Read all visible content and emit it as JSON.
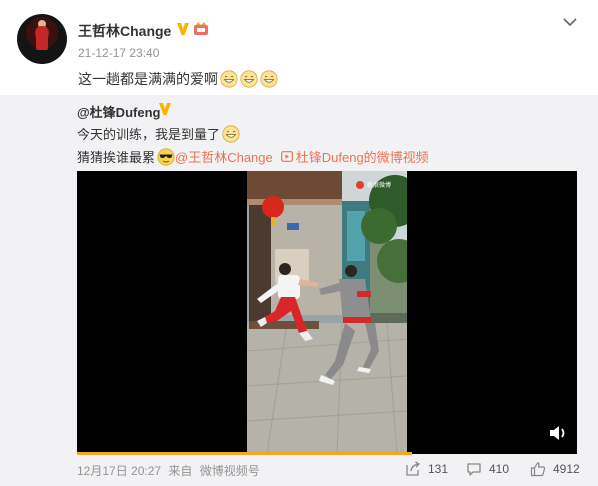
{
  "post": {
    "username": "王哲林Change",
    "timestamp": "21-12-17 23:40",
    "text": "这一趟都是满满的爱啊",
    "emoji_count": 3,
    "emoji_icon": "grin-emoji-icon"
  },
  "repost": {
    "original_user": "@杜锋Dufeng",
    "line1": "今天的训练，我是到量了",
    "line2_prefix": "猜猜挨谁最累",
    "mention": "@王哲林Change",
    "video_link": "杜锋Dufeng的微博视频",
    "video_progress_percent": 67,
    "watermark": "新浪微博",
    "meta": {
      "date": "12月17日 20:27",
      "from_label": "来自",
      "source": "微博视频号"
    },
    "actions": {
      "repost_count": "131",
      "comment_count": "410",
      "like_count": "4912"
    }
  },
  "colors": {
    "accent_link": "#eb7350",
    "progress": "#f5a623",
    "verified_badge": "#f8b500",
    "repost_background": "#f2f2f5"
  }
}
